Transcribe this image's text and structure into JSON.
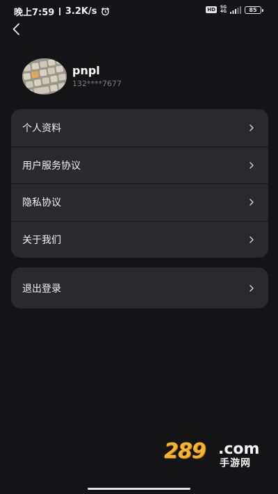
{
  "status_bar": {
    "time": "晚上7:59",
    "speed": "3.2K/s",
    "hd": "HD",
    "network_top": "5G",
    "network_bottom": "4G",
    "battery": "85",
    "icons": [
      "alarm-icon",
      "signal-icon",
      "battery-icon"
    ]
  },
  "header": {
    "back_icon": "chevron-left-icon"
  },
  "profile": {
    "username": "pnpl",
    "phone": "132****7677"
  },
  "menu": {
    "items": [
      {
        "label": "个人资料"
      },
      {
        "label": "用户服务协议"
      },
      {
        "label": "隐私协议"
      },
      {
        "label": "关于我们"
      }
    ],
    "chevron_icon": "chevron-right-icon"
  },
  "logout": {
    "label": "退出登录"
  },
  "watermark": {
    "number": "289",
    "domain": ".com",
    "sub": "手游网"
  },
  "colors": {
    "background": "#141416",
    "card": "#2a2a2d",
    "text": "#f4f4f4",
    "muted": "#7c7c80",
    "watermark_orange": "#f3b52a"
  }
}
